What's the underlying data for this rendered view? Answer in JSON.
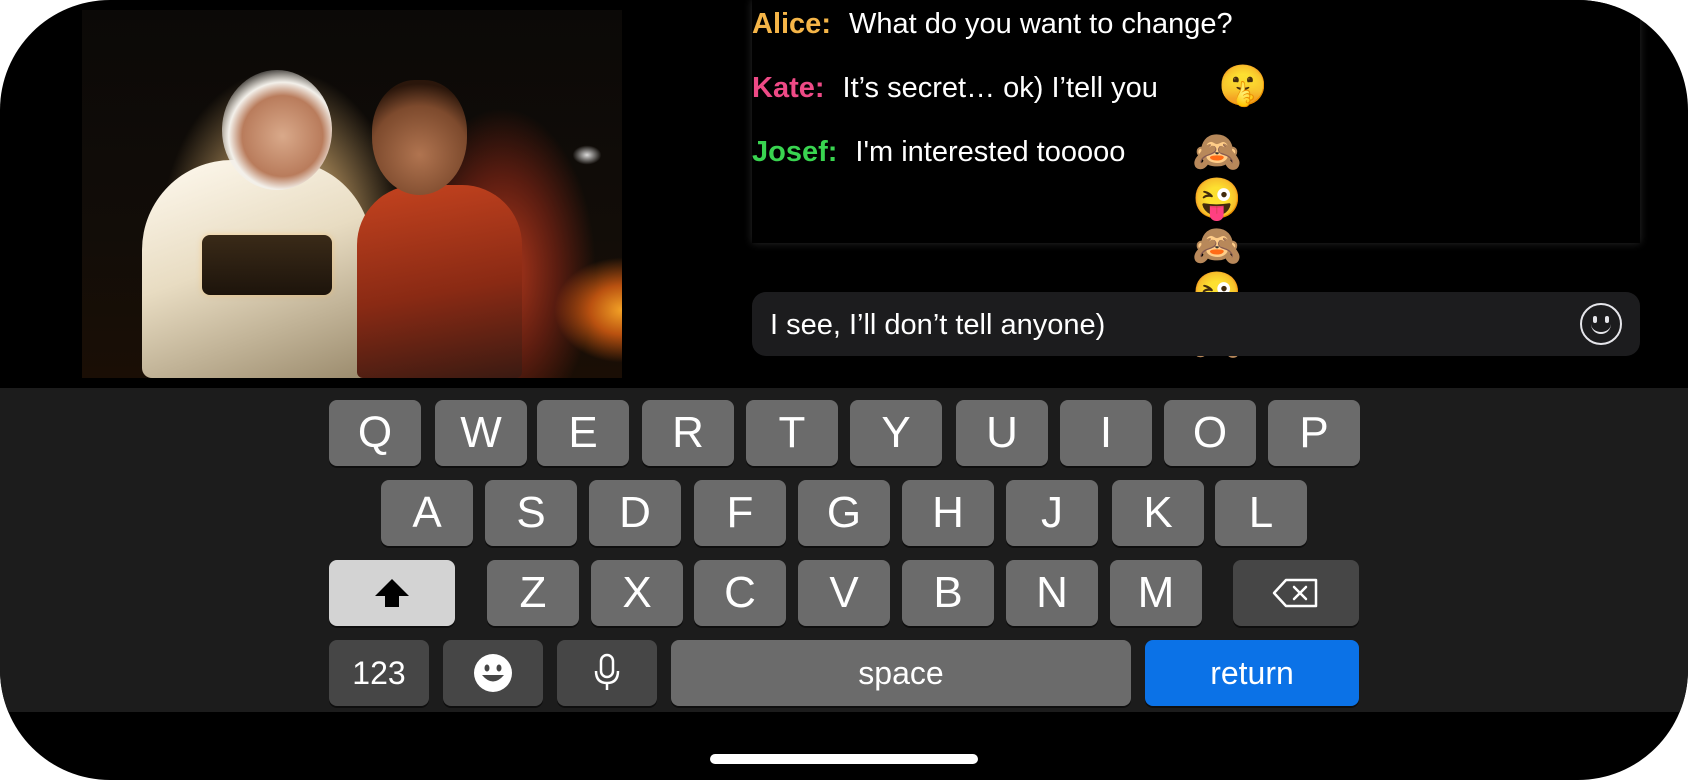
{
  "chat": {
    "messages": [
      {
        "name": "Alice:",
        "color": "#f5b548",
        "text": "What do you want to change?",
        "emoji": ""
      },
      {
        "name": "Kate:",
        "color": "#ee4a86",
        "text": "It’s secret… ok) I’tell you",
        "emoji": "🤫"
      },
      {
        "name": "Josef:",
        "color": "#39d450",
        "text": "I'm interested tooooo",
        "emoji": "🙈😜🙈😜🙈"
      }
    ]
  },
  "input": {
    "value": "I see, I’ll don’t tell anyone)"
  },
  "icons": {
    "emoji_button": "smiley-face-icon",
    "shift": "shift-arrow-icon",
    "delete": "delete-backspace-icon",
    "emoji_key": "emoji-face-icon",
    "mic": "microphone-icon"
  },
  "keyboard": {
    "row1": [
      "Q",
      "W",
      "E",
      "R",
      "T",
      "Y",
      "U",
      "I",
      "O",
      "P"
    ],
    "row2": [
      "A",
      "S",
      "D",
      "F",
      "G",
      "H",
      "J",
      "K",
      "L"
    ],
    "row3": [
      "Z",
      "X",
      "C",
      "V",
      "B",
      "N",
      "M"
    ],
    "numbers_label": "123",
    "space_label": "space",
    "return_label": "return"
  },
  "colors": {
    "return_key": "#0b72e7",
    "keyboard_bg": "#1c1c1c",
    "key": "#6b6b6b"
  }
}
